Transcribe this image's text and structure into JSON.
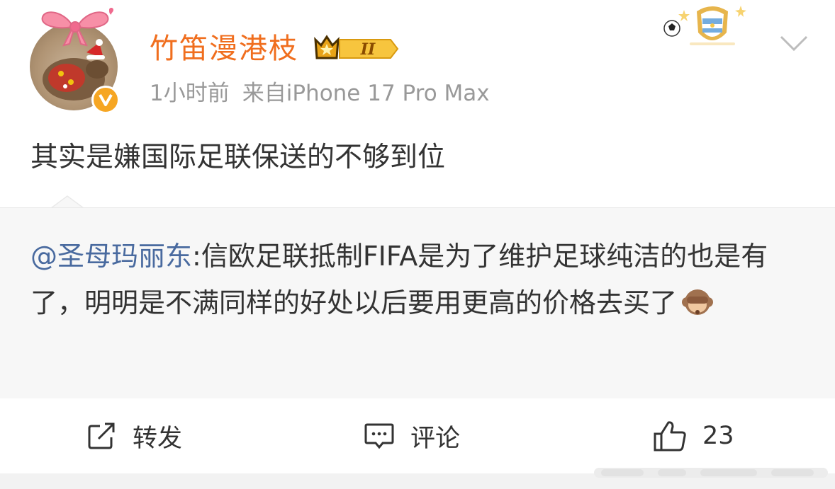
{
  "user": {
    "name": "竹笛漫港枝",
    "level_badge": "II"
  },
  "meta": {
    "time": "1小时前",
    "source": "来自iPhone 17 Pro Max"
  },
  "post": {
    "text": "其实是嫌国际足联保送的不够到位"
  },
  "repost": {
    "mention": "@圣母玛丽东",
    "text": ":信欧足联抵制FIFA是为了维护足球纯洁的也是有了，明明是不满同样的好处以后要用更高的价格去买了",
    "emoji": "see-no-evil-monkey"
  },
  "actions": {
    "repost_label": "转发",
    "comment_label": "评论",
    "like_count": "23"
  },
  "colors": {
    "username": "#f06e1e",
    "mention": "#496a9f",
    "meta": "#999999",
    "verified": "#f6a623"
  },
  "icons": [
    "avatar",
    "bow-icon",
    "verified-icon",
    "level-badge",
    "argentina-shield-icon",
    "soccer-ball-icon",
    "chevron-down-icon",
    "share-icon",
    "comment-icon",
    "like-icon"
  ]
}
